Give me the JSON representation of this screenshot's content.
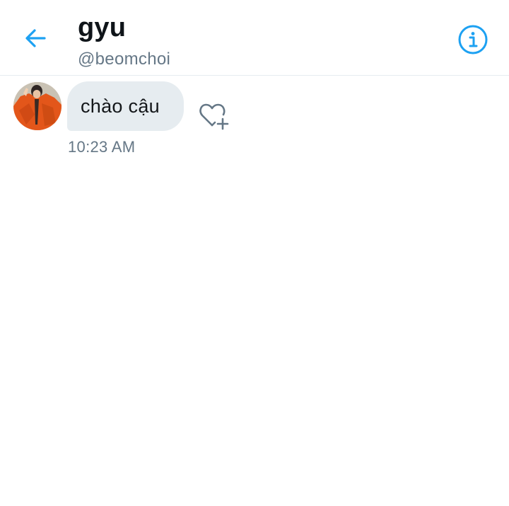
{
  "header": {
    "display_name": "gyu",
    "handle": "@beomchoi",
    "back_icon": "arrow-left-icon",
    "info_icon": "info-circle-icon"
  },
  "conversation": {
    "messages": [
      {
        "sender": "gyu",
        "avatar_icon": "user-avatar",
        "text": "chào cậu",
        "time": "10:23 AM",
        "reaction_icon": "heart-plus-icon"
      }
    ]
  },
  "colors": {
    "accent": "#1da1f2",
    "bubble_bg": "#e6ecf0",
    "secondary_text": "#657786",
    "primary_text": "#14171a",
    "divider": "#e6ecf0"
  }
}
